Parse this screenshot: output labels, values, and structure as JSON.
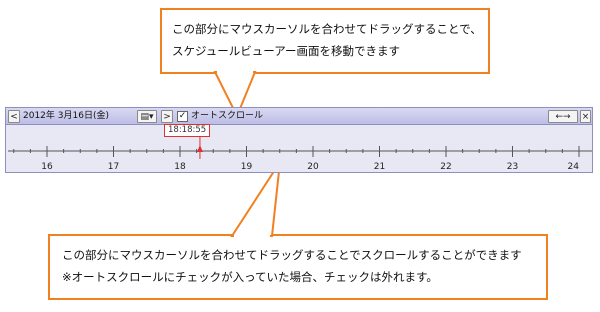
{
  "callouts": {
    "top": {
      "line1": "この部分にマウスカーソルを合わせてドラッグすることで、",
      "line2": "スケジュールビューアー画面を移動できます"
    },
    "bottom": {
      "line1": "この部分にマウスカーソルを合わせてドラッグすることでスクロールすることができます",
      "line2": "※オートスクロールにチェックが入っていた場合、チェックは外れます。"
    }
  },
  "toolbar": {
    "prev_label": "<",
    "date_label": "2012年 3月16日(金)",
    "calendar_label": "▤▾",
    "next_label": ">",
    "auto_scroll_checked": "✓",
    "auto_scroll_label": "オートスクロール",
    "shrink_label": "←→",
    "close_label": "×"
  },
  "timeline": {
    "current_time": "18:18:55",
    "hour_labels": [
      "16",
      "17",
      "18",
      "19",
      "20",
      "21",
      "22",
      "23",
      "24"
    ],
    "cursor_hour": 18.3
  },
  "colors": {
    "callout_border": "#f08020",
    "marker": "#e03030",
    "bar": "#bdbde6"
  }
}
